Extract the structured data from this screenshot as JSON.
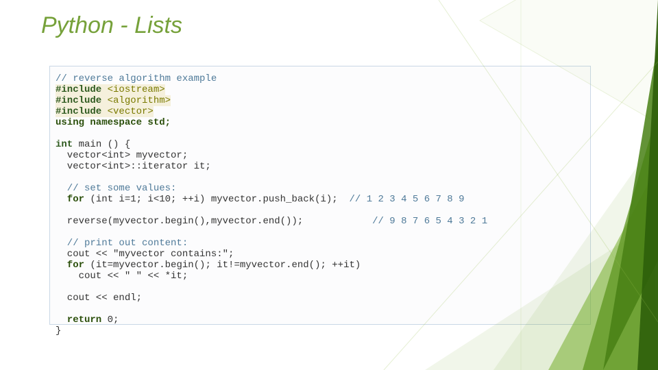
{
  "title": "Python - Lists",
  "code": {
    "l1_comment": "// reverse algorithm example",
    "l2_pp": "#include",
    "l2_file": " <iostream>",
    "l3_pp": "#include",
    "l3_file": " <algorithm>",
    "l4_pp": "#include",
    "l4_file": " <vector>",
    "l5": "using namespace std;",
    "blank": " ",
    "l6a": "int",
    "l6b": " main () {",
    "l7": "  vector<int> myvector;",
    "l8": "  vector<int>::iterator it;",
    "l9_comment": "  // set some values:",
    "l10a": "  for",
    "l10b": " (int i=1; i<10; ++i) myvector.push_back(i);  ",
    "l10c": "// 1 2 3 4 5 6 7 8 9",
    "l11a": "  reverse(myvector.begin(),myvector.end());",
    "l11b": "            ",
    "l11c": "// 9 8 7 6 5 4 3 2 1",
    "l12_comment": "  // print out content:",
    "l13": "  cout << \"myvector contains:\";",
    "l14a": "  for",
    "l14b": " (it=myvector.begin(); it!=myvector.end(); ++it)",
    "l15": "    cout << \" \" << *it;",
    "l16": "  cout << endl;",
    "l17a": "  return",
    "l17b": " 0;",
    "l18": "}"
  }
}
